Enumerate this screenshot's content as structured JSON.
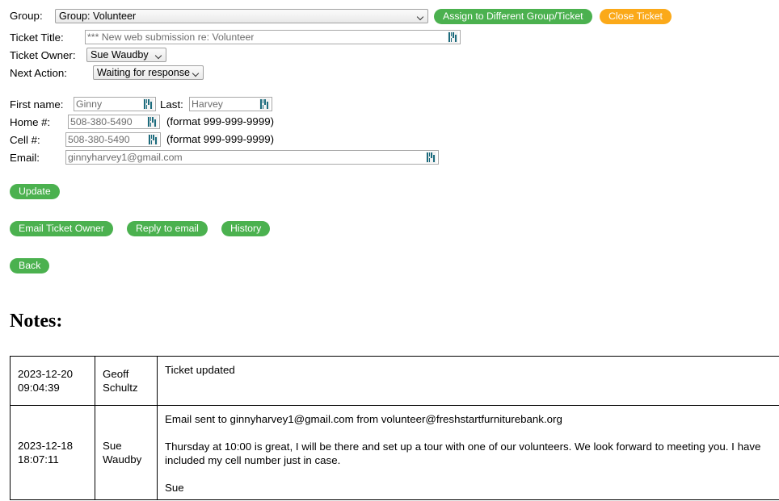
{
  "header": {
    "group_label": "Group:",
    "group_value": "Group: Volunteer",
    "assign_button": "Assign to Different Group/Ticket",
    "close_button": "Close Ticket",
    "ticket_title_label": "Ticket Title:",
    "ticket_title_value": "*** New web submission re: Volunteer",
    "ticket_owner_label": "Ticket Owner:",
    "ticket_owner_value": "Sue Waudby",
    "next_action_label": "Next Action:",
    "next_action_value": "Waiting for response"
  },
  "contact": {
    "first_name_label": "First name:",
    "first_name_value": "Ginny",
    "last_name_label": "Last:",
    "last_name_value": "Harvey",
    "home_label": "Home #:",
    "home_value": "508-380-5490",
    "home_hint": "(format 999-999-9999)",
    "cell_label": "Cell #:",
    "cell_value": "508-380-5490",
    "cell_hint": "(format 999-999-9999)",
    "email_label": "Email:",
    "email_value": "ginnyharvey1@gmail.com"
  },
  "actions": {
    "update": "Update",
    "email_ticket_owner": "Email Ticket Owner",
    "reply_to_email": "Reply to email",
    "history": "History",
    "back": "Back"
  },
  "notes": {
    "heading": "Notes:",
    "rows": [
      {
        "date": "2023-12-20\n09:04:39",
        "user": "Geoff\nSchultz",
        "body": [
          "Ticket updated"
        ]
      },
      {
        "date": "2023-12-18\n18:07:11",
        "user": "Sue\nWaudby",
        "body": [
          "Email sent to ginnyharvey1@gmail.com from volunteer@freshstartfurniturebank.org",
          "Thursday at 10:00 is great, I will be there and set up a tour with one of our volunteers. We look forward to meeting you. I have included my cell number just in case.",
          "Sue"
        ]
      }
    ]
  },
  "colors": {
    "green": "#4bb14f",
    "orange": "#fba919",
    "autofill_icon": "#1c6b7d"
  },
  "icons": {
    "autofill": "autofill-barcode-icon",
    "dropdown": "chevron-down-icon"
  }
}
